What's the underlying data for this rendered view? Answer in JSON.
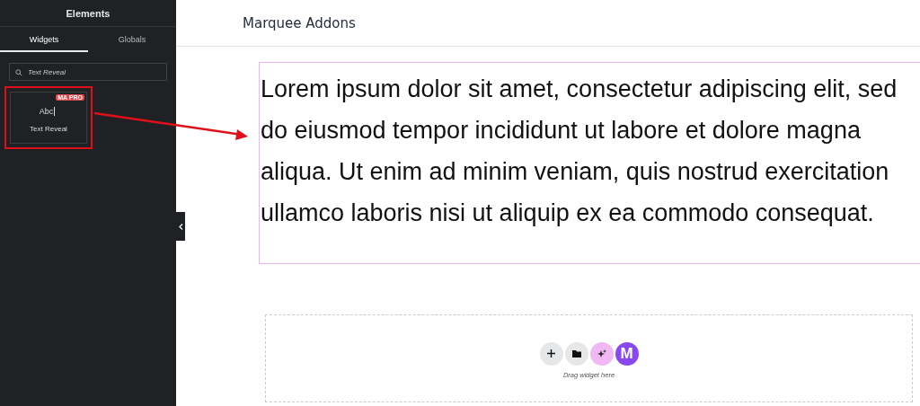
{
  "sidebar": {
    "title": "Elements",
    "tabs": [
      {
        "label": "Widgets",
        "selected": true
      },
      {
        "label": "Globals",
        "selected": false
      }
    ],
    "search": {
      "value": "Text Reveal"
    },
    "widgets": [
      {
        "preview": "Abc",
        "label": "Text Reveal",
        "badge": "MA PRO",
        "highlighted": true
      }
    ]
  },
  "page": {
    "title": "Marquee Addons",
    "text": "Lorem ipsum dolor sit amet, consectetur adipiscing elit, sed do eiusmod tempor incididunt ut labore et dolore magna aliqua. Ut enim ad minim veniam, quis nostrud exercitation ullamco laboris nisi ut aliquip ex ea commodo consequat.",
    "drop_zone": {
      "buttons": [
        {
          "kind": "add"
        },
        {
          "kind": "folder"
        },
        {
          "kind": "ai"
        },
        {
          "kind": "logo",
          "label": "M"
        }
      ],
      "hint": "Drag widget here"
    }
  }
}
